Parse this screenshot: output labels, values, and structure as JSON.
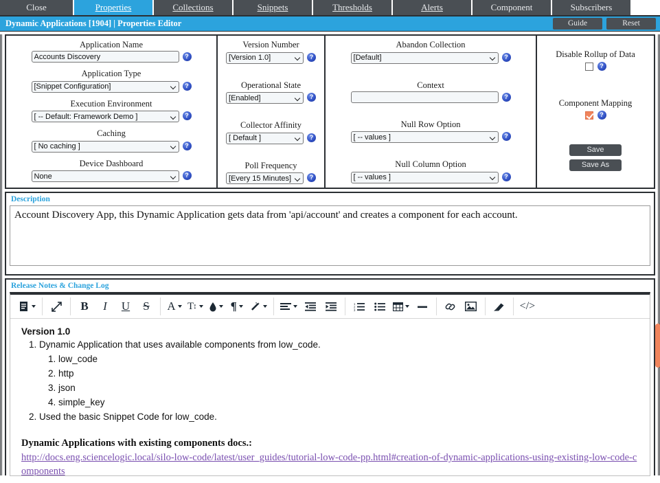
{
  "tabs": [
    {
      "label": "Close",
      "accel": "",
      "active": false,
      "name": "tab-close"
    },
    {
      "label": "Properties",
      "accel": "P",
      "active": true,
      "name": "tab-properties"
    },
    {
      "label": "Collections",
      "accel": "C",
      "active": false,
      "name": "tab-collections"
    },
    {
      "label": "Snippets",
      "accel": "S",
      "active": false,
      "name": "tab-snippets"
    },
    {
      "label": "Thresholds",
      "accel": "T",
      "active": false,
      "name": "tab-thresholds"
    },
    {
      "label": "Alerts",
      "accel": "A",
      "active": false,
      "name": "tab-alerts"
    },
    {
      "label": "Component",
      "accel": "",
      "active": false,
      "name": "tab-component"
    },
    {
      "label": "Subscribers",
      "accel": "",
      "active": false,
      "name": "tab-subscribers"
    }
  ],
  "titlebar": {
    "title": "Dynamic Applications [1904] | Properties Editor",
    "guide_label": "Guide",
    "reset_label": "Reset",
    "background_color": "#2ca3dd"
  },
  "form": {
    "column1": [
      {
        "label": "Application Name",
        "value": "Accounts Discovery",
        "type": "text",
        "name": "application-name"
      },
      {
        "label": "Application Type",
        "value": "[Snippet Configuration]",
        "type": "select",
        "name": "application-type"
      },
      {
        "label": "Execution Environment",
        "value": "[ -- Default: Framework Demo ]",
        "type": "select",
        "name": "execution-environment"
      },
      {
        "label": "Caching",
        "value": "[ No caching ]",
        "type": "select",
        "name": "caching"
      },
      {
        "label": "Device Dashboard",
        "value": "None",
        "type": "select",
        "name": "device-dashboard"
      }
    ],
    "column2": [
      {
        "label": "Version Number",
        "value": "[Version 1.0]",
        "type": "select",
        "name": "version-number"
      },
      {
        "label": "Operational State",
        "value": "[Enabled]",
        "type": "select",
        "name": "operational-state"
      },
      {
        "label": "Collector Affinity",
        "value": "[ Default ]",
        "type": "select",
        "name": "collector-affinity"
      },
      {
        "label": "Poll Frequency",
        "value": "[Every 15 Minutes]",
        "type": "select",
        "name": "poll-frequency"
      }
    ],
    "column3": [
      {
        "label": "Abandon Collection",
        "value": "[Default]",
        "type": "select",
        "name": "abandon-collection"
      },
      {
        "label": "Context",
        "value": "",
        "type": "text",
        "name": "context"
      },
      {
        "label": "Null Row Option",
        "value": "[ -- values ]",
        "type": "select",
        "name": "null-row-option"
      },
      {
        "label": "Null Column Option",
        "value": "[ -- values ]",
        "type": "select",
        "name": "null-column-option"
      }
    ],
    "column4": {
      "disable_rollup_label": "Disable Rollup of Data",
      "disable_rollup_checked": false,
      "component_mapping_label": "Component Mapping",
      "component_mapping_checked": true,
      "component_mapping_color": "#f0845c",
      "save_label": "Save",
      "save_as_label": "Save As"
    }
  },
  "description": {
    "section_title": "Description",
    "value": "Account Discovery App, this Dynamic Application gets data from 'api/account' and creates a component for each account."
  },
  "release_notes": {
    "section_title": "Release Notes & Change Log",
    "toolbar_groups": [
      {
        "items": [
          {
            "icon": "document-icon",
            "name": "paragraph-format-button",
            "glyph": "doc",
            "caret": true
          }
        ]
      },
      {
        "items": [
          {
            "icon": "fullscreen-icon",
            "name": "fullscreen-button",
            "glyph": "arrows",
            "caret": false
          }
        ]
      },
      {
        "items": [
          {
            "icon": "bold-icon",
            "name": "bold-button",
            "glyph": "B",
            "caret": false
          },
          {
            "icon": "italic-icon",
            "name": "italic-button",
            "glyph": "I",
            "caret": false
          },
          {
            "icon": "underline-icon",
            "name": "underline-button",
            "glyph": "U",
            "caret": false
          },
          {
            "icon": "strikethrough-icon",
            "name": "strikethrough-button",
            "glyph": "S",
            "caret": false
          }
        ]
      },
      {
        "items": [
          {
            "icon": "font-family-icon",
            "name": "font-family-button",
            "glyph": "A",
            "caret": true
          },
          {
            "icon": "font-size-icon",
            "name": "font-size-button",
            "glyph": "TI",
            "caret": true
          },
          {
            "icon": "text-color-icon",
            "name": "text-color-button",
            "glyph": "drop",
            "caret": true
          },
          {
            "icon": "paragraph-icon",
            "name": "paragraph-style-button",
            "glyph": "pilcrow",
            "caret": true
          },
          {
            "icon": "magic-wand-icon",
            "name": "inline-style-button",
            "glyph": "wand",
            "caret": true
          }
        ]
      },
      {
        "items": [
          {
            "icon": "align-left-icon",
            "name": "align-button",
            "glyph": "align",
            "caret": true
          },
          {
            "icon": "outdent-icon",
            "name": "outdent-button",
            "glyph": "outdent",
            "caret": false
          },
          {
            "icon": "indent-icon",
            "name": "indent-button",
            "glyph": "indent",
            "caret": false
          }
        ]
      },
      {
        "items": [
          {
            "icon": "ordered-list-icon",
            "name": "ordered-list-button",
            "glyph": "ol",
            "caret": false
          },
          {
            "icon": "unordered-list-icon",
            "name": "unordered-list-button",
            "glyph": "ul",
            "caret": false
          },
          {
            "icon": "table-icon",
            "name": "insert-table-button",
            "glyph": "table",
            "caret": true
          },
          {
            "icon": "horizontal-rule-icon",
            "name": "horizontal-rule-button",
            "glyph": "hr",
            "caret": false
          }
        ]
      },
      {
        "items": [
          {
            "icon": "link-icon",
            "name": "insert-link-button",
            "glyph": "link",
            "caret": false
          },
          {
            "icon": "image-icon",
            "name": "insert-image-button",
            "glyph": "image",
            "caret": false
          }
        ]
      },
      {
        "items": [
          {
            "icon": "eraser-icon",
            "name": "clear-format-button",
            "glyph": "eraser",
            "caret": false
          }
        ]
      },
      {
        "items": [
          {
            "icon": "code-view-icon",
            "name": "code-view-button",
            "glyph": "code",
            "caret": false
          }
        ]
      }
    ],
    "content": {
      "version_title": "Version 1.0",
      "list": [
        {
          "text": "Dynamic Application that uses available components from low_code.",
          "sub": [
            "low_code",
            "http",
            "json",
            "simple_key"
          ]
        },
        {
          "text": "Used the basic Snippet Code for low_code.",
          "sub": []
        }
      ],
      "docs_title": "Dynamic Applications with existing components docs.:",
      "docs_url": "http://docs.eng.sciencelogic.local/silo-low-code/latest/user_guides/tutorial-low-code-pp.html#creation-of-dynamic-applications-using-existing-low-code-components",
      "link_color": "#7a4fb0"
    },
    "scrollbar_color": "#f0845c"
  }
}
